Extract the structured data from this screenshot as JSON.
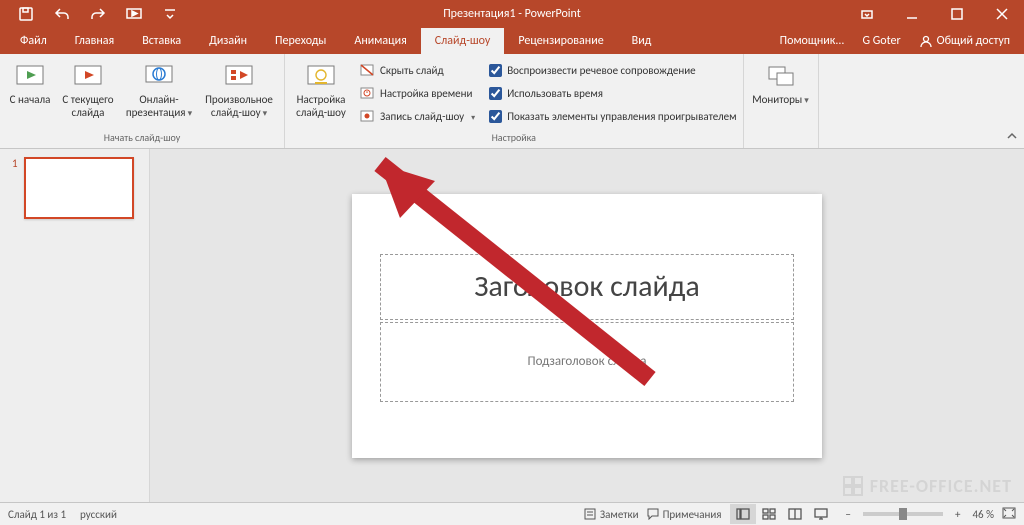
{
  "title": "Презентация1 - PowerPoint",
  "tabs": {
    "file": "Файл",
    "home": "Главная",
    "insert": "Вставка",
    "design": "Дизайн",
    "transitions": "Переходы",
    "animation": "Анимация",
    "slideshow": "Слайд-шоу",
    "review": "Рецензирование",
    "view": "Вид",
    "helper": "Помощник...",
    "user": "G Goter",
    "share": "Общий доступ"
  },
  "ribbon": {
    "group_start": "Начать слайд-шоу",
    "from_beginning": "С\nначала",
    "from_current": "С текущего\nслайда",
    "online": "Онлайн-\nпрезентация",
    "custom": "Произвольное\nслайд-шоу",
    "group_setup": "Настройка",
    "setup": "Настройка\nслайд-шоу",
    "hide_slide": "Скрыть слайд",
    "rehearse": "Настройка времени",
    "record": "Запись слайд-шоу",
    "chk_narration": "Воспроизвести речевое сопровождение",
    "chk_timings": "Использовать время",
    "chk_controls": "Показать элементы управления проигрывателем",
    "monitors": "Мониторы"
  },
  "slide": {
    "title_ph": "Заголовок слайда",
    "subtitle_ph": "Подзаголовок слайда",
    "thumb_num": "1"
  },
  "status": {
    "slide_count": "Слайд 1 из 1",
    "lang": "русский",
    "notes": "Заметки",
    "comments": "Примечания",
    "zoom": "46 %"
  },
  "watermark": "FREE-OFFICE.NET"
}
